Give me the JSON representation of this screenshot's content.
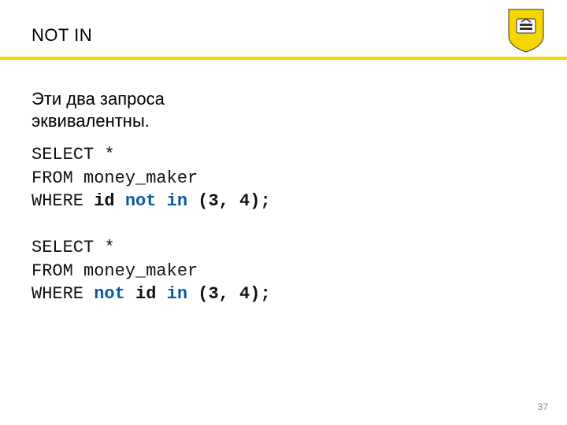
{
  "title": "NOT IN",
  "subtitle_line1": "Эти два запроса",
  "subtitle_line2": "эквивалентны.",
  "code1": {
    "l1": "SELECT *",
    "l2": "FROM money_maker",
    "l3a": "WHERE ",
    "l3_id": "id",
    "l3_sp1": " ",
    "l3_not": "not",
    "l3_sp2": " ",
    "l3_in": "in",
    "l3_sp3": " ",
    "l3b": "(3, 4);"
  },
  "code2": {
    "l1": "SELECT *",
    "l2": "FROM money_maker",
    "l3a": "WHERE ",
    "l3_not": "not",
    "l3_sp1": " ",
    "l3_id": "id",
    "l3_sp2": " ",
    "l3_in": "in",
    "l3_sp3": " ",
    "l3b": "(3, 4);"
  },
  "page_number": "37"
}
